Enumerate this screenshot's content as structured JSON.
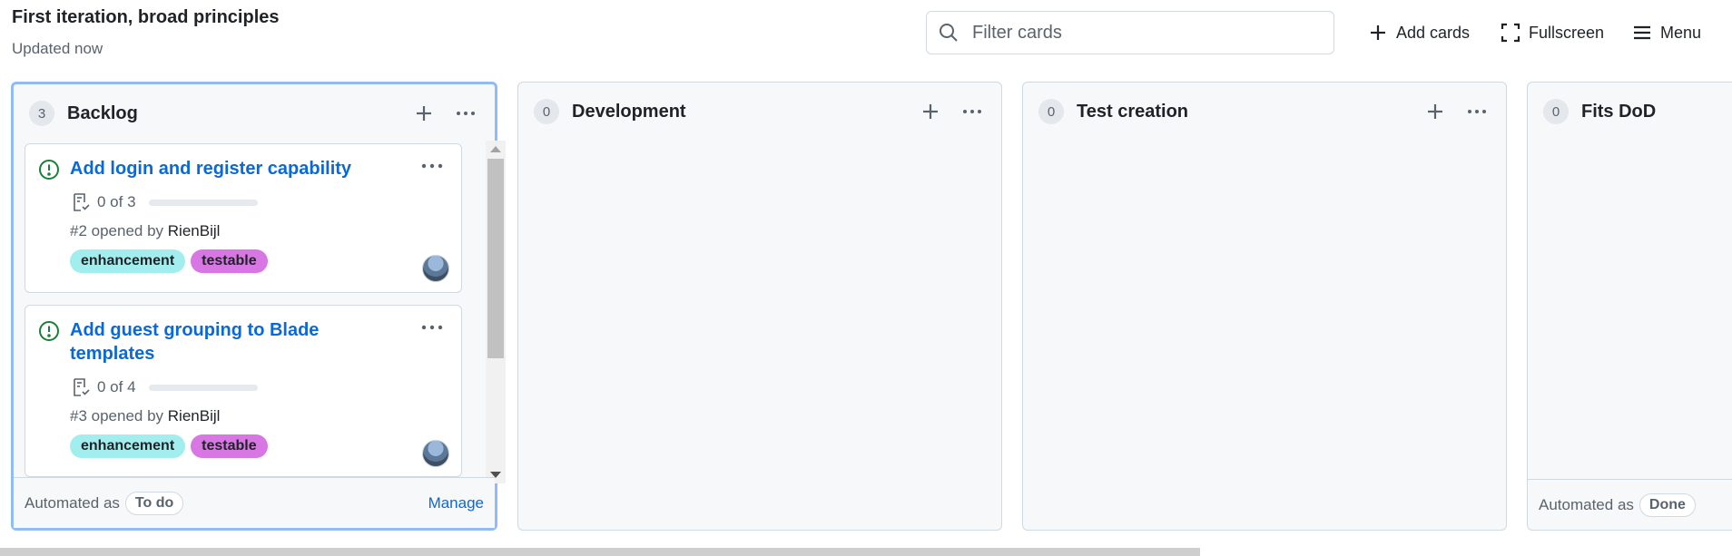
{
  "header": {
    "title": "First iteration, broad principles",
    "subtitle": "Updated now",
    "filter_placeholder": "Filter cards",
    "add_cards": "Add cards",
    "fullscreen": "Fullscreen",
    "menu": "Menu"
  },
  "columns": [
    {
      "count": "3",
      "name": "Backlog",
      "footer_automated": "Automated as",
      "footer_status": "To do",
      "footer_manage": "Manage",
      "cards": [
        {
          "title": "Add login and register capability",
          "tasks": "0 of 3",
          "meta_prefix": "#2 opened by",
          "author": "RienBijl",
          "labels": [
            {
              "name": "enhancement",
              "color": "#a2eeef"
            },
            {
              "name": "testable",
              "color": "#d876e3"
            }
          ]
        },
        {
          "title": "Add guest grouping to Blade templates",
          "tasks": "0 of 4",
          "meta_prefix": "#3 opened by",
          "author": "RienBijl",
          "labels": [
            {
              "name": "enhancement",
              "color": "#a2eeef"
            },
            {
              "name": "testable",
              "color": "#d876e3"
            }
          ]
        }
      ]
    },
    {
      "count": "0",
      "name": "Development"
    },
    {
      "count": "0",
      "name": "Test creation"
    },
    {
      "count": "0",
      "name": "Fits DoD",
      "footer_automated": "Automated as",
      "footer_status": "Done"
    }
  ],
  "colors": {
    "accent_blue": "#0969da",
    "issue_open_green": "#1a7f37",
    "selected_border": "#90bbf5",
    "column_bg": "#f6f8fa"
  }
}
